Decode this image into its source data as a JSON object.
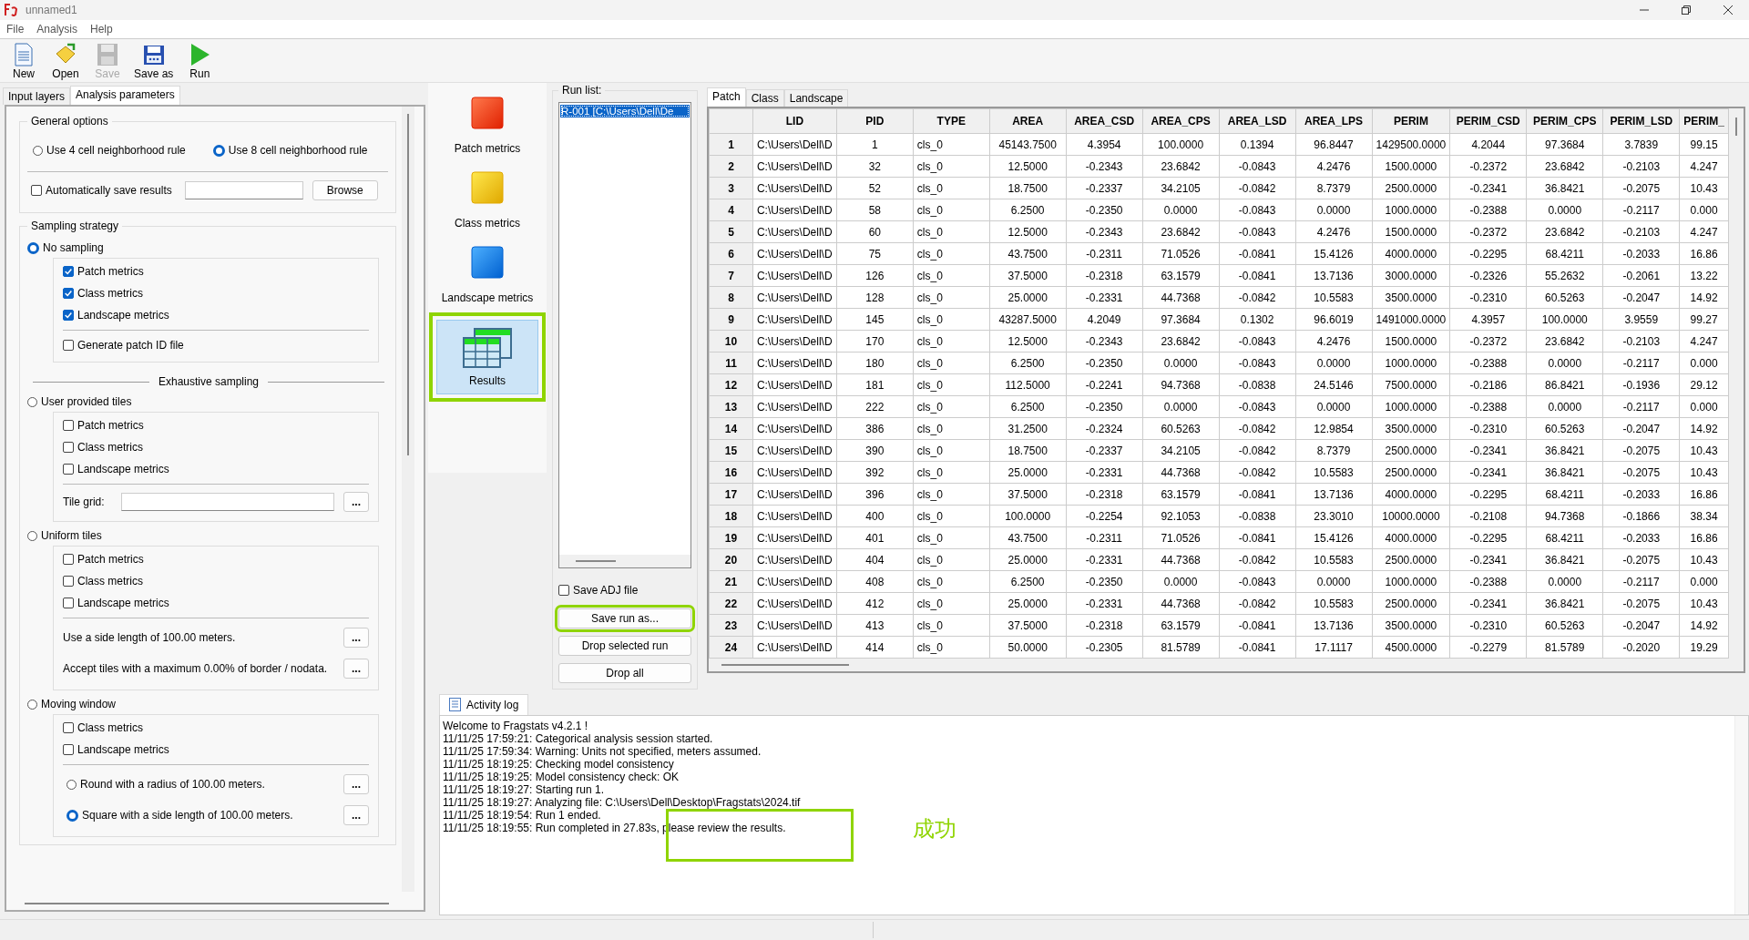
{
  "window": {
    "title": "unnamed1"
  },
  "menu": [
    "File",
    "Analysis",
    "Help"
  ],
  "toolbar": [
    {
      "label": "New",
      "kind": "new",
      "disabled": false
    },
    {
      "label": "Open",
      "kind": "open",
      "disabled": false
    },
    {
      "label": "Save",
      "kind": "save",
      "disabled": true
    },
    {
      "label": "Save as",
      "kind": "saveas",
      "disabled": false
    },
    {
      "label": "Run",
      "kind": "run",
      "disabled": false
    }
  ],
  "left_tabs": [
    {
      "label": "Input layers",
      "selected": false
    },
    {
      "label": "Analysis parameters",
      "selected": true
    }
  ],
  "general_options": {
    "title": "General options",
    "neighborhood": [
      {
        "label": "Use 4 cell neighborhood rule",
        "selected": false
      },
      {
        "label": "Use 8 cell neighborhood rule",
        "selected": true
      }
    ],
    "auto_save": {
      "label": "Automatically save results",
      "checked": false
    },
    "browse": "Browse"
  },
  "sampling_strategy": {
    "title": "Sampling strategy",
    "no_sampling": {
      "label": "No sampling",
      "selected": true,
      "options": [
        {
          "label": "Patch metrics",
          "checked": true
        },
        {
          "label": "Class metrics",
          "checked": true
        },
        {
          "label": "Landscape metrics",
          "checked": true
        }
      ],
      "patch_id": {
        "label": "Generate patch ID file",
        "checked": false
      }
    },
    "exhaustive_title": "Exhaustive sampling",
    "user_tiles": {
      "label": "User provided tiles",
      "selected": false,
      "options": [
        {
          "label": "Patch metrics",
          "checked": false
        },
        {
          "label": "Class metrics",
          "checked": false
        },
        {
          "label": "Landscape metrics",
          "checked": false
        }
      ],
      "tile_grid_label": "Tile grid:",
      "more": "..."
    },
    "uniform_tiles": {
      "label": "Uniform tiles",
      "selected": false,
      "options": [
        {
          "label": "Patch metrics",
          "checked": false
        },
        {
          "label": "Class metrics",
          "checked": false
        },
        {
          "label": "Landscape metrics",
          "checked": false
        }
      ],
      "settings": [
        {
          "text": "Use a side length of 100.00 meters.",
          "more": "..."
        },
        {
          "text": "Accept tiles with a maximum 0.00% of border / nodata.",
          "more": "..."
        }
      ]
    },
    "moving_window": {
      "label": "Moving window",
      "selected": false,
      "options": [
        {
          "label": "Class metrics",
          "checked": false
        },
        {
          "label": "Landscape metrics",
          "checked": false
        }
      ],
      "shapes": [
        {
          "label": "Round with a radius of 100.00 meters.",
          "selected": false,
          "more": "..."
        },
        {
          "label": "Square with a side length of 100.00 meters.",
          "selected": true,
          "more": "..."
        }
      ]
    }
  },
  "nav": [
    {
      "label": "Patch metrics",
      "kind": "patch",
      "selected": false,
      "highlighted": false
    },
    {
      "label": "Class metrics",
      "kind": "class",
      "selected": false,
      "highlighted": false
    },
    {
      "label": "Landscape metrics",
      "kind": "landscape",
      "selected": false,
      "highlighted": false
    },
    {
      "label": "Results",
      "kind": "results",
      "selected": true,
      "highlighted": true
    }
  ],
  "run_list": {
    "title": "Run list:",
    "runs": [
      {
        "label": "R-001 [C:\\Users\\Dell\\De",
        "selected": true
      }
    ],
    "save_adj": {
      "label": "Save ADJ file",
      "checked": false
    },
    "buttons": [
      {
        "label": "Save run as...",
        "highlighted": true
      },
      {
        "label": "Drop selected run",
        "highlighted": false
      },
      {
        "label": "Drop all",
        "highlighted": false
      }
    ]
  },
  "results_tabs": [
    {
      "label": "Patch",
      "selected": true
    },
    {
      "label": "Class",
      "selected": false
    },
    {
      "label": "Landscape",
      "selected": false
    }
  ],
  "table": {
    "columns": [
      "LID",
      "PID",
      "TYPE",
      "AREA",
      "AREA_CSD",
      "AREA_CPS",
      "AREA_LSD",
      "AREA_LPS",
      "PERIM",
      "PERIM_CSD",
      "PERIM_CPS",
      "PERIM_LSD",
      "PERIM_"
    ],
    "rows": [
      {
        "num": "1",
        "cells": [
          "C:\\Users\\Dell\\D",
          "1",
          "cls_0",
          "45143.7500",
          "4.3954",
          "100.0000",
          "0.1394",
          "96.8447",
          "1429500.0000",
          "4.2044",
          "97.3684",
          "3.7839",
          "99.15"
        ]
      },
      {
        "num": "2",
        "cells": [
          "C:\\Users\\Dell\\D",
          "32",
          "cls_0",
          "12.5000",
          "-0.2343",
          "23.6842",
          "-0.0843",
          "4.2476",
          "1500.0000",
          "-0.2372",
          "23.6842",
          "-0.2103",
          "4.247"
        ]
      },
      {
        "num": "3",
        "cells": [
          "C:\\Users\\Dell\\D",
          "52",
          "cls_0",
          "18.7500",
          "-0.2337",
          "34.2105",
          "-0.0842",
          "8.7379",
          "2500.0000",
          "-0.2341",
          "36.8421",
          "-0.2075",
          "10.43"
        ]
      },
      {
        "num": "4",
        "cells": [
          "C:\\Users\\Dell\\D",
          "58",
          "cls_0",
          "6.2500",
          "-0.2350",
          "0.0000",
          "-0.0843",
          "0.0000",
          "1000.0000",
          "-0.2388",
          "0.0000",
          "-0.2117",
          "0.000"
        ]
      },
      {
        "num": "5",
        "cells": [
          "C:\\Users\\Dell\\D",
          "60",
          "cls_0",
          "12.5000",
          "-0.2343",
          "23.6842",
          "-0.0843",
          "4.2476",
          "1500.0000",
          "-0.2372",
          "23.6842",
          "-0.2103",
          "4.247"
        ]
      },
      {
        "num": "6",
        "cells": [
          "C:\\Users\\Dell\\D",
          "75",
          "cls_0",
          "43.7500",
          "-0.2311",
          "71.0526",
          "-0.0841",
          "15.4126",
          "4000.0000",
          "-0.2295",
          "68.4211",
          "-0.2033",
          "16.86"
        ]
      },
      {
        "num": "7",
        "cells": [
          "C:\\Users\\Dell\\D",
          "126",
          "cls_0",
          "37.5000",
          "-0.2318",
          "63.1579",
          "-0.0841",
          "13.7136",
          "3000.0000",
          "-0.2326",
          "55.2632",
          "-0.2061",
          "13.22"
        ]
      },
      {
        "num": "8",
        "cells": [
          "C:\\Users\\Dell\\D",
          "128",
          "cls_0",
          "25.0000",
          "-0.2331",
          "44.7368",
          "-0.0842",
          "10.5583",
          "3500.0000",
          "-0.2310",
          "60.5263",
          "-0.2047",
          "14.92"
        ]
      },
      {
        "num": "9",
        "cells": [
          "C:\\Users\\Dell\\D",
          "145",
          "cls_0",
          "43287.5000",
          "4.2049",
          "97.3684",
          "0.1302",
          "96.6019",
          "1491000.0000",
          "4.3957",
          "100.0000",
          "3.9559",
          "99.27"
        ]
      },
      {
        "num": "10",
        "cells": [
          "C:\\Users\\Dell\\D",
          "170",
          "cls_0",
          "12.5000",
          "-0.2343",
          "23.6842",
          "-0.0843",
          "4.2476",
          "1500.0000",
          "-0.2372",
          "23.6842",
          "-0.2103",
          "4.247"
        ]
      },
      {
        "num": "11",
        "cells": [
          "C:\\Users\\Dell\\D",
          "180",
          "cls_0",
          "6.2500",
          "-0.2350",
          "0.0000",
          "-0.0843",
          "0.0000",
          "1000.0000",
          "-0.2388",
          "0.0000",
          "-0.2117",
          "0.000"
        ]
      },
      {
        "num": "12",
        "cells": [
          "C:\\Users\\Dell\\D",
          "181",
          "cls_0",
          "112.5000",
          "-0.2241",
          "94.7368",
          "-0.0838",
          "24.5146",
          "7500.0000",
          "-0.2186",
          "86.8421",
          "-0.1936",
          "29.12"
        ]
      },
      {
        "num": "13",
        "cells": [
          "C:\\Users\\Dell\\D",
          "222",
          "cls_0",
          "6.2500",
          "-0.2350",
          "0.0000",
          "-0.0843",
          "0.0000",
          "1000.0000",
          "-0.2388",
          "0.0000",
          "-0.2117",
          "0.000"
        ]
      },
      {
        "num": "14",
        "cells": [
          "C:\\Users\\Dell\\D",
          "386",
          "cls_0",
          "31.2500",
          "-0.2324",
          "60.5263",
          "-0.0842",
          "12.9854",
          "3500.0000",
          "-0.2310",
          "60.5263",
          "-0.2047",
          "14.92"
        ]
      },
      {
        "num": "15",
        "cells": [
          "C:\\Users\\Dell\\D",
          "390",
          "cls_0",
          "18.7500",
          "-0.2337",
          "34.2105",
          "-0.0842",
          "8.7379",
          "2500.0000",
          "-0.2341",
          "36.8421",
          "-0.2075",
          "10.43"
        ]
      },
      {
        "num": "16",
        "cells": [
          "C:\\Users\\Dell\\D",
          "392",
          "cls_0",
          "25.0000",
          "-0.2331",
          "44.7368",
          "-0.0842",
          "10.5583",
          "2500.0000",
          "-0.2341",
          "36.8421",
          "-0.2075",
          "10.43"
        ]
      },
      {
        "num": "17",
        "cells": [
          "C:\\Users\\Dell\\D",
          "396",
          "cls_0",
          "37.5000",
          "-0.2318",
          "63.1579",
          "-0.0841",
          "13.7136",
          "4000.0000",
          "-0.2295",
          "68.4211",
          "-0.2033",
          "16.86"
        ]
      },
      {
        "num": "18",
        "cells": [
          "C:\\Users\\Dell\\D",
          "400",
          "cls_0",
          "100.0000",
          "-0.2254",
          "92.1053",
          "-0.0838",
          "23.3010",
          "10000.0000",
          "-0.2108",
          "94.7368",
          "-0.1866",
          "38.34"
        ]
      },
      {
        "num": "19",
        "cells": [
          "C:\\Users\\Dell\\D",
          "401",
          "cls_0",
          "43.7500",
          "-0.2311",
          "71.0526",
          "-0.0841",
          "15.4126",
          "4000.0000",
          "-0.2295",
          "68.4211",
          "-0.2033",
          "16.86"
        ]
      },
      {
        "num": "20",
        "cells": [
          "C:\\Users\\Dell\\D",
          "404",
          "cls_0",
          "25.0000",
          "-0.2331",
          "44.7368",
          "-0.0842",
          "10.5583",
          "2500.0000",
          "-0.2341",
          "36.8421",
          "-0.2075",
          "10.43"
        ]
      },
      {
        "num": "21",
        "cells": [
          "C:\\Users\\Dell\\D",
          "408",
          "cls_0",
          "6.2500",
          "-0.2350",
          "0.0000",
          "-0.0843",
          "0.0000",
          "1000.0000",
          "-0.2388",
          "0.0000",
          "-0.2117",
          "0.000"
        ]
      },
      {
        "num": "22",
        "cells": [
          "C:\\Users\\Dell\\D",
          "412",
          "cls_0",
          "25.0000",
          "-0.2331",
          "44.7368",
          "-0.0842",
          "10.5583",
          "2500.0000",
          "-0.2341",
          "36.8421",
          "-0.2075",
          "10.43"
        ]
      },
      {
        "num": "23",
        "cells": [
          "C:\\Users\\Dell\\D",
          "413",
          "cls_0",
          "37.5000",
          "-0.2318",
          "63.1579",
          "-0.0841",
          "13.7136",
          "3500.0000",
          "-0.2310",
          "60.5263",
          "-0.2047",
          "14.92"
        ]
      },
      {
        "num": "24",
        "cells": [
          "C:\\Users\\Dell\\D",
          "414",
          "cls_0",
          "50.0000",
          "-0.2305",
          "81.5789",
          "-0.0841",
          "17.1117",
          "4500.0000",
          "-0.2279",
          "81.5789",
          "-0.2020",
          "19.29"
        ]
      }
    ]
  },
  "activity_log": {
    "title": "Activity log",
    "lines": [
      "Welcome to Fragstats v4.2.1 !",
      "11/11/25 17:59:21: Categorical analysis session started.",
      "11/11/25 17:59:34: Warning: Units not specified, meters assumed.",
      "11/11/25 18:19:25: Checking model consistency",
      "11/11/25 18:19:25: Model consistency check: OK",
      "11/11/25 18:19:27: Starting run 1.",
      "11/11/25 18:19:27: Analyzing file: C:\\Users\\Dell\\Desktop\\Fragstats\\2024.tif",
      "11/11/25 18:19:54: Run 1 ended.",
      "11/11/25 18:19:55: Run completed in 27.83s, please review the results."
    ],
    "annotation": "成功"
  }
}
